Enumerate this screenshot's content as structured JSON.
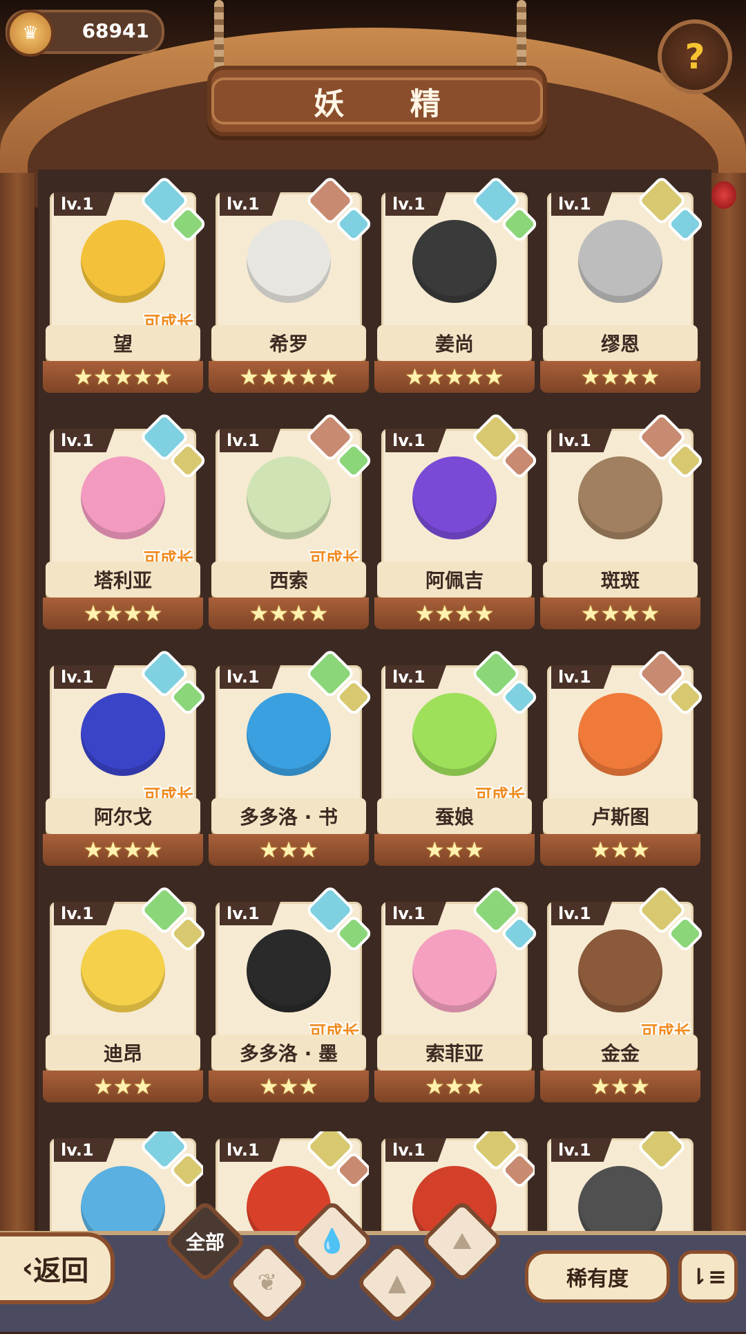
{
  "header": {
    "title": "妖 精",
    "coins": "68941"
  },
  "level_label": "lv.1",
  "growable_label": "可成长",
  "elements": {
    "water": "#7fd0e0",
    "grass": "#8cd67a",
    "earth": "#d8c870",
    "fire": "#c88a70"
  },
  "cards": [
    {
      "name": "望",
      "stars": "★★★★★",
      "growable": true,
      "color": "#f3c23a",
      "elem1": "water",
      "elem2": "grass"
    },
    {
      "name": "希罗",
      "stars": "★★★★★",
      "growable": false,
      "color": "#e8e6e0",
      "elem1": "fire",
      "elem2": "water"
    },
    {
      "name": "姜尚",
      "stars": "★★★★★",
      "growable": false,
      "color": "#3a3a3a",
      "elem1": "water",
      "elem2": "grass"
    },
    {
      "name": "缪恩",
      "stars": "★★★★",
      "growable": false,
      "color": "#bdbdbd",
      "elem1": "earth",
      "elem2": "water"
    },
    {
      "name": "塔利亚",
      "stars": "★★★★",
      "growable": true,
      "color": "#f29ac0",
      "elem1": "water",
      "elem2": "earth"
    },
    {
      "name": "西索",
      "stars": "★★★★",
      "growable": true,
      "color": "#cfe3b4",
      "elem1": "fire",
      "elem2": "grass"
    },
    {
      "name": "阿佩吉",
      "stars": "★★★★",
      "growable": false,
      "color": "#7a4ad6",
      "elem1": "earth",
      "elem2": "fire"
    },
    {
      "name": "斑斑",
      "stars": "★★★★",
      "growable": false,
      "color": "#a08060",
      "elem1": "fire",
      "elem2": "earth"
    },
    {
      "name": "阿尔戈",
      "stars": "★★★★",
      "growable": true,
      "color": "#3a44c8",
      "elem1": "water",
      "elem2": "grass"
    },
    {
      "name": "多多洛 · 书",
      "stars": "★★★",
      "growable": false,
      "color": "#3aa0e0",
      "elem1": "grass",
      "elem2": "earth"
    },
    {
      "name": "蚕娘",
      "stars": "★★★",
      "growable": true,
      "color": "#9ee05a",
      "elem1": "grass",
      "elem2": "water"
    },
    {
      "name": "卢斯图",
      "stars": "★★★",
      "growable": false,
      "color": "#f07a3a",
      "elem1": "fire",
      "elem2": "earth"
    },
    {
      "name": "迪昂",
      "stars": "★★★",
      "growable": false,
      "color": "#f5d04a",
      "elem1": "grass",
      "elem2": "earth"
    },
    {
      "name": "多多洛 · 墨",
      "stars": "★★★",
      "growable": true,
      "color": "#2a2a2a",
      "elem1": "water",
      "elem2": "grass"
    },
    {
      "name": "索菲亚",
      "stars": "★★★",
      "growable": false,
      "color": "#f5a0c0",
      "elem1": "grass",
      "elem2": "water"
    },
    {
      "name": "金金",
      "stars": "★★★",
      "growable": true,
      "color": "#8a5a3a",
      "elem1": "earth",
      "elem2": "grass"
    }
  ],
  "partial_cards": [
    {
      "color": "#5ab0e0",
      "elem1": "water",
      "elem2": "earth"
    },
    {
      "color": "#d8402a",
      "elem1": "earth",
      "elem2": "fire"
    },
    {
      "color": "#d2402a",
      "elem1": "earth",
      "elem2": "fire"
    },
    {
      "color": "#505050",
      "elem1": "earth",
      "elem2": ""
    }
  ],
  "bottom": {
    "back": "返回",
    "filter_all": "全部",
    "rarity": "稀有度",
    "sort_icon": "sort-icon"
  }
}
